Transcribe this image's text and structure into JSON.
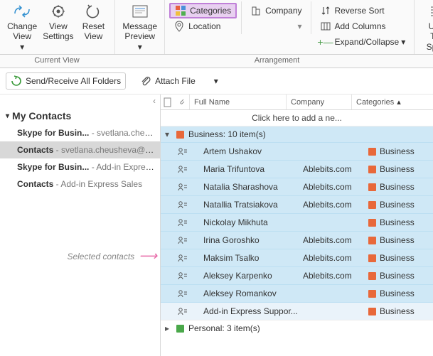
{
  "ribbon": {
    "changeView": "Change View",
    "viewSettings": "View Settings",
    "resetView": "Reset View",
    "messagePreview": "Message Preview",
    "categories": "Categories",
    "company": "Company",
    "location": "Location",
    "reverseSort": "Reverse Sort",
    "addColumns": "Add Columns",
    "expandCollapse": "Expand/Collapse",
    "useTight": "Use Tig",
    "spacing": "Spac",
    "groupCurrentView": "Current View",
    "groupArrangement": "Arrangement"
  },
  "toolbar": {
    "sendReceive": "Send/Receive All Folders",
    "attachFile": "Attach File"
  },
  "nav": {
    "header": "My Contacts",
    "items": [
      {
        "label": "Skype for Busin...",
        "secondary": "- svetlana.cheus..."
      },
      {
        "label": "Contacts",
        "secondary": "- svetlana.cheusheva@a..."
      },
      {
        "label": "Skype for Busin...",
        "secondary": "- Add-in Express..."
      },
      {
        "label": "Contacts",
        "secondary": "- Add-in Express Sales"
      }
    ],
    "selectedIndex": 1,
    "annotation": "Selected contacts"
  },
  "list": {
    "headers": {
      "fullName": "Full Name",
      "company": "Company",
      "categories": "Categories"
    },
    "addNew": "Click here to add a ne...",
    "groups": [
      {
        "label": "Business: 10 item(s)",
        "swatch": "business",
        "expanded": true
      },
      {
        "label": "Personal: 3 item(s)",
        "swatch": "personal",
        "expanded": false
      }
    ],
    "contacts": [
      {
        "name": "Artem Ushakov",
        "company": "",
        "category": "Business"
      },
      {
        "name": "Maria Trifuntova",
        "company": "Ablebits.com",
        "category": "Business"
      },
      {
        "name": "Natalia Sharashova",
        "company": "Ablebits.com",
        "category": "Business"
      },
      {
        "name": "Natallia Tratsiakova",
        "company": "Ablebits.com",
        "category": "Business"
      },
      {
        "name": "Nickolay Mikhuta",
        "company": "",
        "category": "Business"
      },
      {
        "name": "Irina Goroshko",
        "company": "Ablebits.com",
        "category": "Business"
      },
      {
        "name": "Maksim Tsalko",
        "company": "Ablebits.com",
        "category": "Business"
      },
      {
        "name": "Aleksey Karpenko",
        "company": "Ablebits.com",
        "category": "Business"
      },
      {
        "name": "Aleksey Romankov",
        "company": "",
        "category": "Business"
      },
      {
        "name": "Add-in Express Suppor...",
        "company": "",
        "category": "Business"
      }
    ]
  }
}
